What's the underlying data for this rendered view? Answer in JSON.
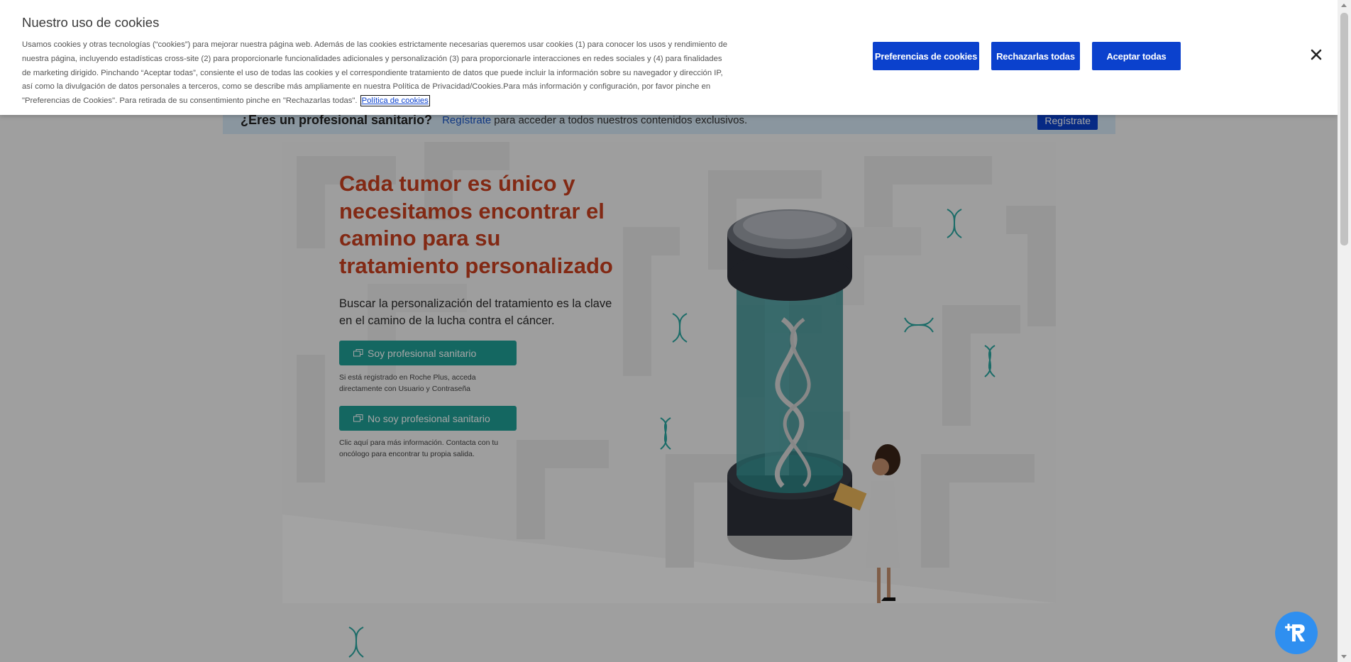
{
  "cookie_banner": {
    "title": "Nuestro uso de cookies",
    "body": "Usamos cookies y otras tecnologías (“cookies”) para mejorar nuestra página web. Además de las cookies estrictamente necesarias queremos usar cookies (1) para conocer los usos y rendimiento de nuestra página, incluyendo estadísticas cross-site (2) para proporcionarle funcionalidades adicionales y personalización (3) para proporcionarle interacciones en redes sociales y (4) para finalidades de marketing dirigido. Pinchando “Aceptar todas”, consiente el uso de todas las cookies y el correspondiente tratamiento de datos que puede incluir la información sobre su navegador y dirección IP, así como la divulgación de datos personales a terceros, como se describe más ampliamente en nuestra Política de Privacidad/Cookies.Para más información y configuración, por favor pinche en \"Preferencias de Cookies\". Para retirada de su consentimiento pinche en \"Rechazarlas todas\".",
    "policy_link": "Política de cookies",
    "preferences_button": "Preferencias de cookies",
    "reject_button": "Rechazarlas todas",
    "accept_button": "Aceptar todas",
    "close_icon": "close-icon"
  },
  "pro_banner": {
    "question": "¿Eres un profesional sanitario?",
    "register_link": "Regístrate",
    "rest_text": "para acceder a todos nuestros contenidos exclusivos.",
    "register_button": "Regístrate"
  },
  "hero": {
    "title": "Cada tumor es único y necesitamos encontrar el camino para su tratamiento personalizado",
    "subtitle": "Buscar la personalización del tratamiento es la clave en el camino de la lucha contra el cáncer.",
    "cta_pro": "Soy profesional sanitario",
    "cta_pro_note": "Si está registrado en Roche Plus, acceda directamente con Usuario y Contraseña",
    "cta_nonpro": "No soy profesional sanitario",
    "cta_nonpro_note": "Clic aquí para más información. Contacta con tu oncólogo para encontrar tu propia salida."
  },
  "colors": {
    "roche_blue": "#0b41cd",
    "title_orange": "#c8401f",
    "teal": "#1f9e96",
    "chat_blue": "#2f8ff0"
  },
  "icons": [
    "close-icon",
    "external-window-icon",
    "dna-icon",
    "chat-bot-icon"
  ]
}
